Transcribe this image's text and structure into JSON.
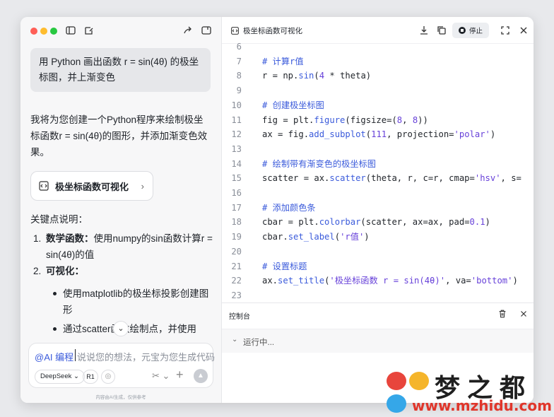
{
  "chat": {
    "user_message": "用 Python 画出函数 r = sin(4θ) 的极坐标图，并上渐变色",
    "reply_intro": "我将为您创建一个Python程序来绘制极坐标函数r = sin(4θ)的图形，并添加渐变色效果。",
    "artifact_card_label": "极坐标函数可视化",
    "key_points_heading": "关键点说明：",
    "ordered": [
      {
        "num": "1.",
        "label": "数学函数：",
        "text": "使用numpy的sin函数计算r = sin(4θ)的值"
      },
      {
        "num": "2.",
        "label": "可视化：",
        "text": ""
      }
    ],
    "bullets": [
      "使用matplotlib的极坐标投影创建图形",
      "通过scatter函数绘制点，并使用"
    ],
    "composer": {
      "mode": "@AI 编程",
      "placeholder": "说说您的想法，元宝为您生成代码",
      "model": "DeepSeek ⌄",
      "r1": "R1"
    },
    "disclaimer": "内容由AI生成，仅供参考"
  },
  "code_pane": {
    "title": "极坐标函数可视化",
    "stop_label": "停止",
    "lines": [
      {
        "n": "6",
        "html": ""
      },
      {
        "n": "7",
        "html": "<span class='tok-c'># 计算r值</span>"
      },
      {
        "n": "8",
        "html": "r = np.<span class='tok-f'>sin</span>(<span class='tok-n'>4</span> * theta)"
      },
      {
        "n": "9",
        "html": ""
      },
      {
        "n": "10",
        "html": "<span class='tok-c'># 创建极坐标图</span>"
      },
      {
        "n": "11",
        "html": "fig = plt.<span class='tok-f'>figure</span>(figsize=(<span class='tok-n'>8</span>, <span class='tok-n'>8</span>))"
      },
      {
        "n": "12",
        "html": "ax = fig.<span class='tok-f'>add_subplot</span>(<span class='tok-n'>111</span>, projection=<span class='tok-s'>'polar'</span>)"
      },
      {
        "n": "13",
        "html": ""
      },
      {
        "n": "14",
        "html": "<span class='tok-c'># 绘制带有渐变色的极坐标图</span>"
      },
      {
        "n": "15",
        "html": "scatter = ax.<span class='tok-f'>scatter</span>(theta, r, c=r, cmap=<span class='tok-s'>'hsv'</span>, s="
      },
      {
        "n": "16",
        "html": ""
      },
      {
        "n": "17",
        "html": "<span class='tok-c'># 添加颜色条</span>"
      },
      {
        "n": "18",
        "html": "cbar = plt.<span class='tok-f'>colorbar</span>(scatter, ax=ax, pad=<span class='tok-n'>0.1</span>)"
      },
      {
        "n": "19",
        "html": "cbar.<span class='tok-f'>set_label</span>(<span class='tok-s'>'r值'</span>)"
      },
      {
        "n": "20",
        "html": ""
      },
      {
        "n": "21",
        "html": "<span class='tok-c'># 设置标题</span>"
      },
      {
        "n": "22",
        "html": "ax.<span class='tok-f'>set_title</span>(<span class='tok-s'>'极坐标函数 r = sin(4θ)'</span>, va=<span class='tok-s'>'bottom'</span>)"
      },
      {
        "n": "23",
        "html": ""
      }
    ]
  },
  "console": {
    "title": "控制台",
    "status": "运行中..."
  },
  "watermark": {
    "brand_chars": "梦之都",
    "url": "www.mzhidu.com"
  },
  "colors": {
    "accent": "#3b5bdb",
    "string": "#6741d9",
    "traffic_red": "#ff5f57",
    "traffic_yellow": "#febc2e",
    "traffic_green": "#28c840"
  }
}
